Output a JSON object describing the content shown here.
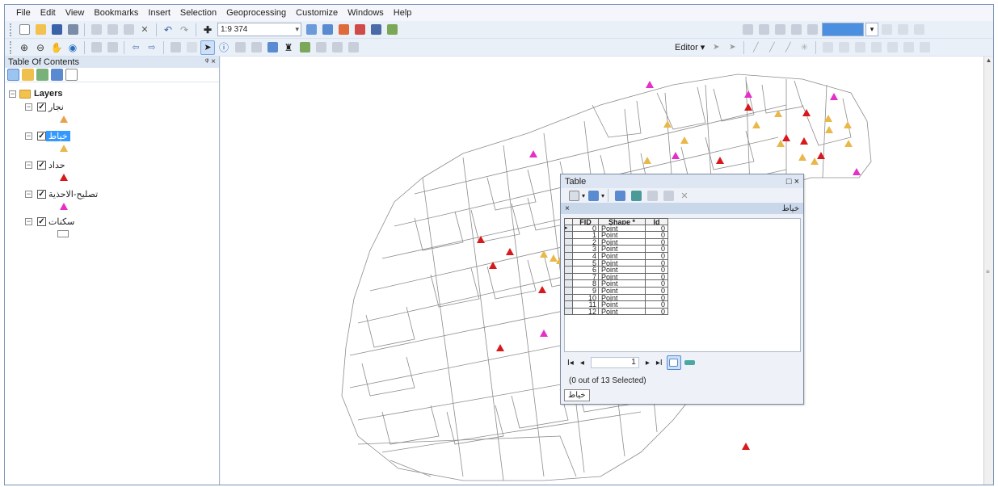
{
  "menu": [
    "File",
    "Edit",
    "View",
    "Bookmarks",
    "Insert",
    "Selection",
    "Geoprocessing",
    "Customize",
    "Windows",
    "Help"
  ],
  "toolbar": {
    "scale": "1:9 374",
    "editor_label": "Editor ▾"
  },
  "toc": {
    "title": "Table Of Contents",
    "title_buttons": "ᵠ ×",
    "root_label": "Layers",
    "layers": [
      {
        "name": "نجار",
        "checked": true,
        "symbol": "triangle",
        "color": "#e8a24a",
        "selected": false
      },
      {
        "name": "خياط",
        "checked": true,
        "symbol": "triangle",
        "color": "#e8b84a",
        "selected": true
      },
      {
        "name": "حداد",
        "checked": true,
        "symbol": "triangle",
        "color": "#d7191c",
        "selected": false
      },
      {
        "name": "تصليح-الاحذية",
        "checked": true,
        "symbol": "triangle",
        "color": "#e62fc9",
        "selected": false
      },
      {
        "name": "سكنات",
        "checked": true,
        "symbol": "rectangle",
        "color": "#ffffff",
        "selected": false
      }
    ]
  },
  "table_window": {
    "title": "Table",
    "close_buttons": "□ ×",
    "tab_label": "خياط",
    "tab_close": "×",
    "columns": [
      "FID",
      "Shape *",
      "Id"
    ],
    "rows": [
      [
        "0",
        "Point",
        "0"
      ],
      [
        "1",
        "Point",
        "0"
      ],
      [
        "2",
        "Point",
        "0"
      ],
      [
        "3",
        "Point",
        "0"
      ],
      [
        "4",
        "Point",
        "0"
      ],
      [
        "5",
        "Point",
        "0"
      ],
      [
        "6",
        "Point",
        "0"
      ],
      [
        "7",
        "Point",
        "0"
      ],
      [
        "8",
        "Point",
        "0"
      ],
      [
        "9",
        "Point",
        "0"
      ],
      [
        "10",
        "Point",
        "0"
      ],
      [
        "11",
        "Point",
        "0"
      ],
      [
        "12",
        "Point",
        "0"
      ]
    ],
    "record_number": "1",
    "nav_first": "I◂",
    "nav_prev": "◂",
    "nav_next": "▸",
    "nav_last": "▸I",
    "selection_status": "(0 out of 13 Selected)",
    "bottom_tab": "خياط"
  },
  "colors": {
    "carpenter": "#e8b84a",
    "tailor": "#e8b84a",
    "blacksmith": "#d7191c",
    "shoe_repair": "#e62fc9",
    "parcel_outline": "#8c8c8c"
  }
}
